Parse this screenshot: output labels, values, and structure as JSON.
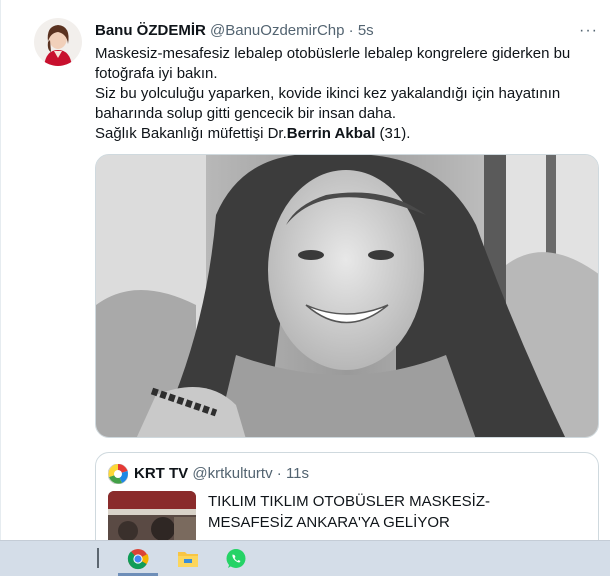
{
  "tweet": {
    "author_name": "Banu ÖZDEMİR",
    "handle": "@BanuOzdemirChp",
    "separator": "·",
    "time": "5s",
    "more_label": "···",
    "lines": [
      "Maskesiz-mesafesiz lebalep otobüslerle lebalep kongrelere giderken bu fotoğrafa iyi bakın.",
      "Siz bu yolculuğu yaparken, kovide ikinci kez yakalandığı için hayatının baharında solup gitti gencecik bir insan daha."
    ],
    "last_line": {
      "prefix": "Sağlık Bakanlığı müfettişi Dr.",
      "bold": "Berrin Akbal",
      "suffix": " (31)."
    }
  },
  "quote": {
    "author_name": "KRT TV",
    "handle": "@krtkulturtv",
    "separator": "·",
    "time": "11s",
    "title": "TIKLIM TIKLIM OTOBÜSLER MASKESİZ-MESAFESİZ ANKARA'YA GELİYOR"
  },
  "taskbar": {
    "items": [
      "chrome-icon",
      "file-explorer-icon",
      "whatsapp-icon"
    ]
  }
}
